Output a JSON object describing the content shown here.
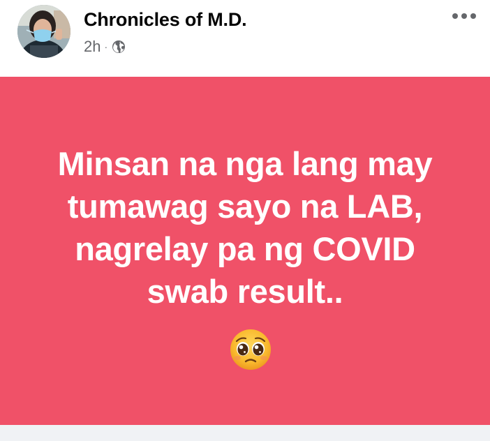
{
  "post": {
    "author": "Chronicles of M.D.",
    "time": "2h",
    "separator": "·",
    "privacy_icon": "globe-icon",
    "more_icon": "more-options-icon",
    "background_color": "#f05168",
    "text_lines": [
      "Minsan na nga lang may",
      "tumawag sayo na LAB,",
      "nagrelay pa ng COVID",
      "swab result.."
    ],
    "emoji": "pleading-face-emoji"
  }
}
